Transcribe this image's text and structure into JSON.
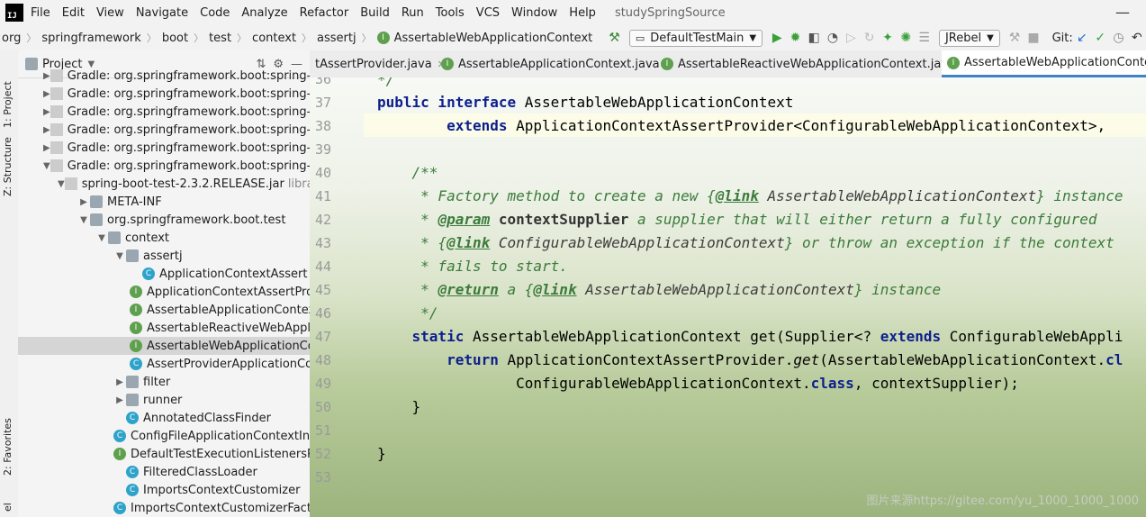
{
  "menu": {
    "items": [
      "File",
      "Edit",
      "View",
      "Navigate",
      "Code",
      "Analyze",
      "Refactor",
      "Build",
      "Run",
      "Tools",
      "VCS",
      "Window",
      "Help"
    ],
    "project_title": "studySpringSource",
    "minimize": "—"
  },
  "nav": {
    "breadcrumbs": [
      "org",
      "springframework",
      "boot",
      "test",
      "context",
      "assertj",
      "AssertableWebApplicationContext"
    ],
    "run_config": "DefaultTestMain",
    "jrebel": "JRebel",
    "git_label": "Git:"
  },
  "left_strip": {
    "project_tab": "1: Project",
    "structure_tab": "Z: Structure",
    "favorites_tab": "2: Favorites",
    "el_tab": "el"
  },
  "project": {
    "title": "Project",
    "rows": [
      {
        "text": "Gradle: org.springframework.boot:spring-boo",
        "kind": "lib"
      },
      {
        "text": "Gradle: org.springframework.boot:spring-boo",
        "kind": "lib"
      },
      {
        "text": "Gradle: org.springframework.boot:spring-boo",
        "kind": "lib"
      },
      {
        "text": "Gradle: org.springframework.boot:spring-boo",
        "kind": "lib"
      },
      {
        "text": "Gradle: org.springframework.boot:spring-boo",
        "kind": "lib"
      },
      {
        "text": "Gradle: org.springframework.boot:spring-boo",
        "kind": "lib"
      },
      {
        "text": "spring-boot-test-2.3.2.RELEASE.jar",
        "suffix": "library",
        "kind": "jar"
      },
      {
        "text": "META-INF",
        "kind": "folder"
      },
      {
        "text": "org.springframework.boot.test",
        "kind": "folder"
      },
      {
        "text": "context",
        "kind": "folder"
      },
      {
        "text": "assertj",
        "kind": "folder"
      },
      {
        "text": "ApplicationContextAssert",
        "kind": "c"
      },
      {
        "text": "ApplicationContextAssertPro",
        "kind": "i"
      },
      {
        "text": "AssertableApplicationContex",
        "kind": "i"
      },
      {
        "text": "AssertableReactiveWebAppl",
        "kind": "i"
      },
      {
        "text": "AssertableWebApplicationCo",
        "kind": "i"
      },
      {
        "text": "AssertProviderApplicationCo",
        "kind": "c"
      },
      {
        "text": "filter",
        "kind": "folder"
      },
      {
        "text": "runner",
        "kind": "folder"
      },
      {
        "text": "AnnotatedClassFinder",
        "kind": "c"
      },
      {
        "text": "ConfigFileApplicationContextInit",
        "kind": "c"
      },
      {
        "text": "DefaultTestExecutionListenersPo",
        "kind": "i"
      },
      {
        "text": "FilteredClassLoader",
        "kind": "c"
      },
      {
        "text": "ImportsContextCustomizer",
        "kind": "c"
      },
      {
        "text": "ImportsContextCustomizerFacto",
        "kind": "c"
      }
    ]
  },
  "tabs": [
    {
      "label": "tAssertProvider.java"
    },
    {
      "label": "AssertableApplicationContext.java"
    },
    {
      "label": "AssertableReactiveWebApplicationContext.java"
    },
    {
      "label": "AssertableWebApplicationContext.j"
    }
  ],
  "editor": {
    "line_numbers": [
      "36",
      "37",
      "38",
      "39",
      "40",
      "41",
      "42",
      "43",
      "44",
      "45",
      "46",
      "47",
      "48",
      "49",
      "50",
      "51",
      "52",
      "53"
    ],
    "watermark": "图片来源https://gitee.com/yu_1000_1000_1000"
  }
}
